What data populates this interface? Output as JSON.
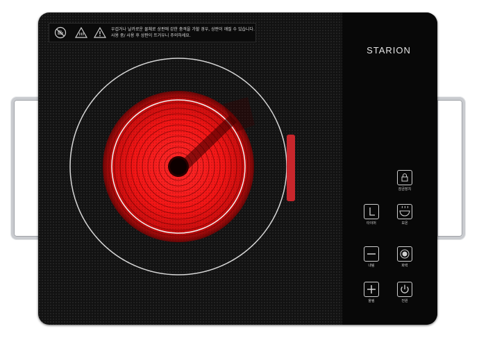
{
  "brand": "STARION",
  "warning": {
    "line1": "우겁거나 날카로운 물체로 상판에 강한 충격을 가할 경우, 상판이 깨질 수 있습니다.",
    "line2": "사용 중/ 사용 후 상판이 뜨거우니 주의하세요.",
    "icons": [
      "no-hand-touch-icon",
      "hot-surface-icon",
      "caution-icon"
    ]
  },
  "burner": {
    "state": "on",
    "glow_color": "#ff1a1a",
    "ring_color": "#d8d8d8",
    "indicator_color": "#c8262c"
  },
  "controls": {
    "lock": {
      "label": "잠금장치",
      "icon": "lock-icon"
    },
    "timer": {
      "label": "타이머",
      "icon": "timer-icon"
    },
    "keep_warm": {
      "label": "보온",
      "icon": "keep-warm-icon"
    },
    "decrease": {
      "label": "내림",
      "icon": "minus-icon"
    },
    "boost": {
      "label": "화력",
      "icon": "boost-icon"
    },
    "increase": {
      "label": "올림",
      "icon": "plus-icon"
    },
    "power": {
      "label": "전원",
      "icon": "power-icon"
    }
  },
  "colors": {
    "glass": "#121212",
    "panel": "#080808",
    "handle": "#c9cbcf",
    "control_outline": "#cfcfcf"
  }
}
